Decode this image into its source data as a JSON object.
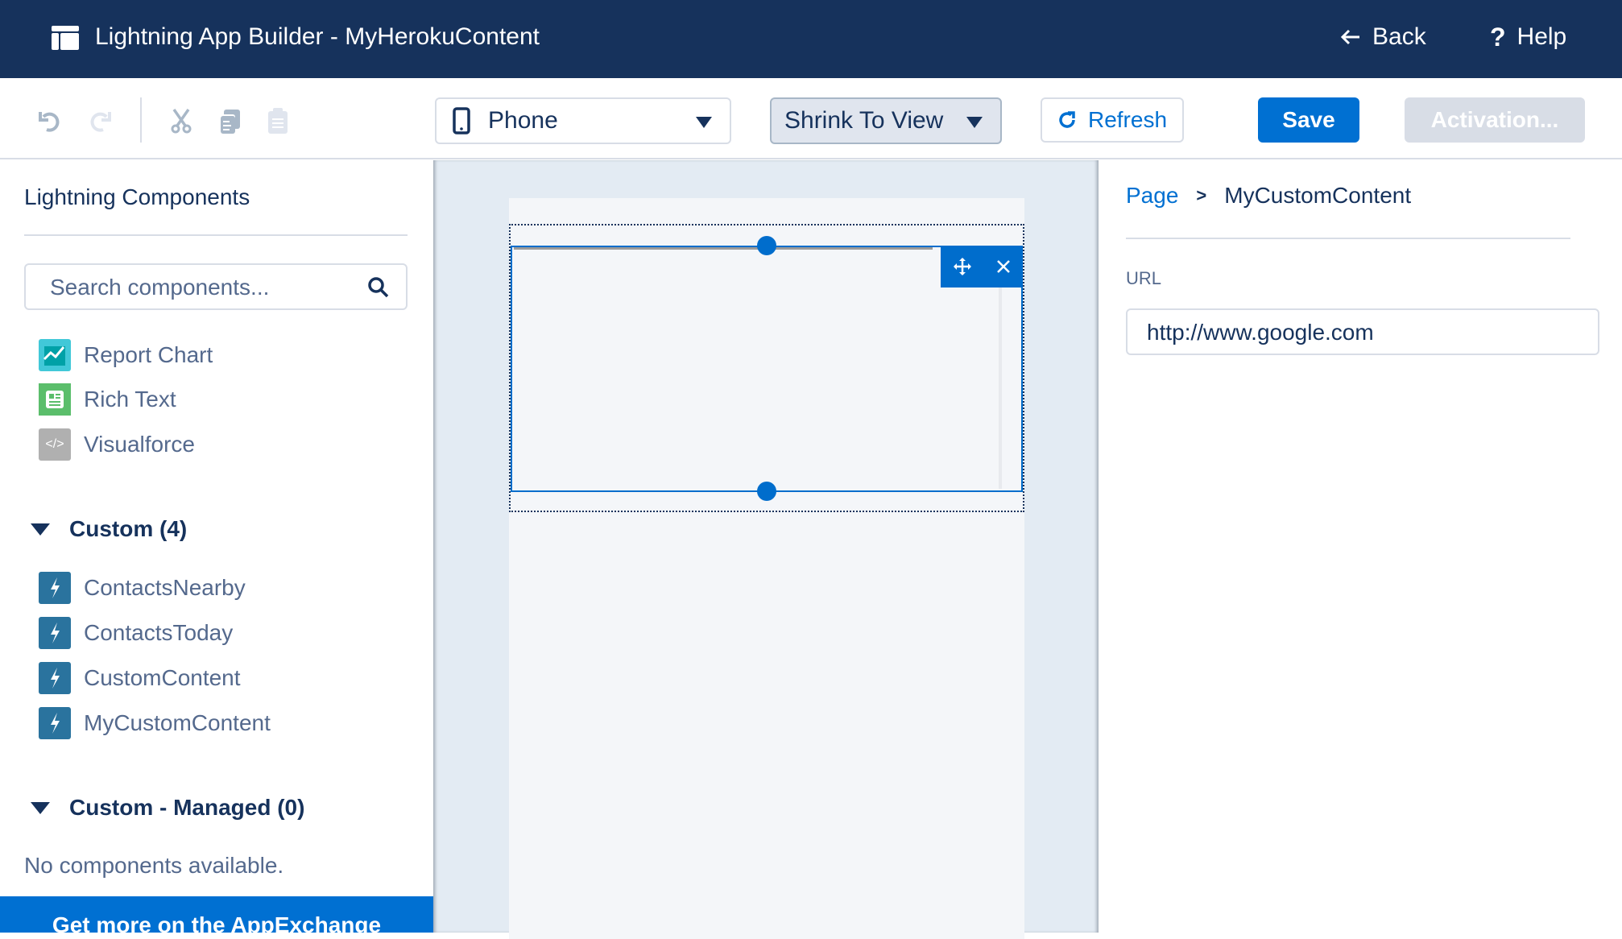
{
  "header": {
    "title": "Lightning App Builder - MyHerokuContent",
    "back_label": "Back",
    "help_label": "Help",
    "background": "#16325c"
  },
  "toolbar": {
    "icons": [
      "undo-icon",
      "redo-icon",
      "cut-icon",
      "copy-icon",
      "paste-icon"
    ],
    "device_select": {
      "value": "Phone",
      "icon": "phone-icon"
    },
    "zoom_select": {
      "value": "Shrink To View"
    },
    "refresh_label": "Refresh",
    "save_label": "Save",
    "activation_label": "Activation...",
    "accent": "#0070d2"
  },
  "left_panel": {
    "title": "Lightning Components",
    "search_placeholder": "Search components...",
    "standard_items": [
      {
        "label": "Report Chart",
        "icon": "report-chart-icon",
        "color": "#41c8d8"
      },
      {
        "label": "Rich Text",
        "icon": "rich-text-icon",
        "color": "#5bbe6b"
      },
      {
        "label": "Visualforce",
        "icon": "visualforce-icon",
        "color": "#b0b0b0"
      }
    ],
    "custom_section": {
      "label": "Custom (4)",
      "items": [
        {
          "label": "ContactsNearby",
          "icon": "lightning-bolt-icon"
        },
        {
          "label": "ContactsToday",
          "icon": "lightning-bolt-icon"
        },
        {
          "label": "CustomContent",
          "icon": "lightning-bolt-icon"
        },
        {
          "label": "MyCustomContent",
          "icon": "lightning-bolt-icon"
        }
      ],
      "icon_color": "#2a739e"
    },
    "managed_section": {
      "label": "Custom - Managed (0)",
      "empty_text": "No components available."
    },
    "appexchange_label": "Get more on the AppExchange"
  },
  "canvas": {
    "selected_component": "MyCustomContent",
    "control_icons": [
      "move-icon",
      "close-icon"
    ]
  },
  "right_panel": {
    "breadcrumb": {
      "root": "Page",
      "separator": ">",
      "current": "MyCustomContent"
    },
    "url_label": "URL",
    "url_value": "http://www.google.com"
  }
}
